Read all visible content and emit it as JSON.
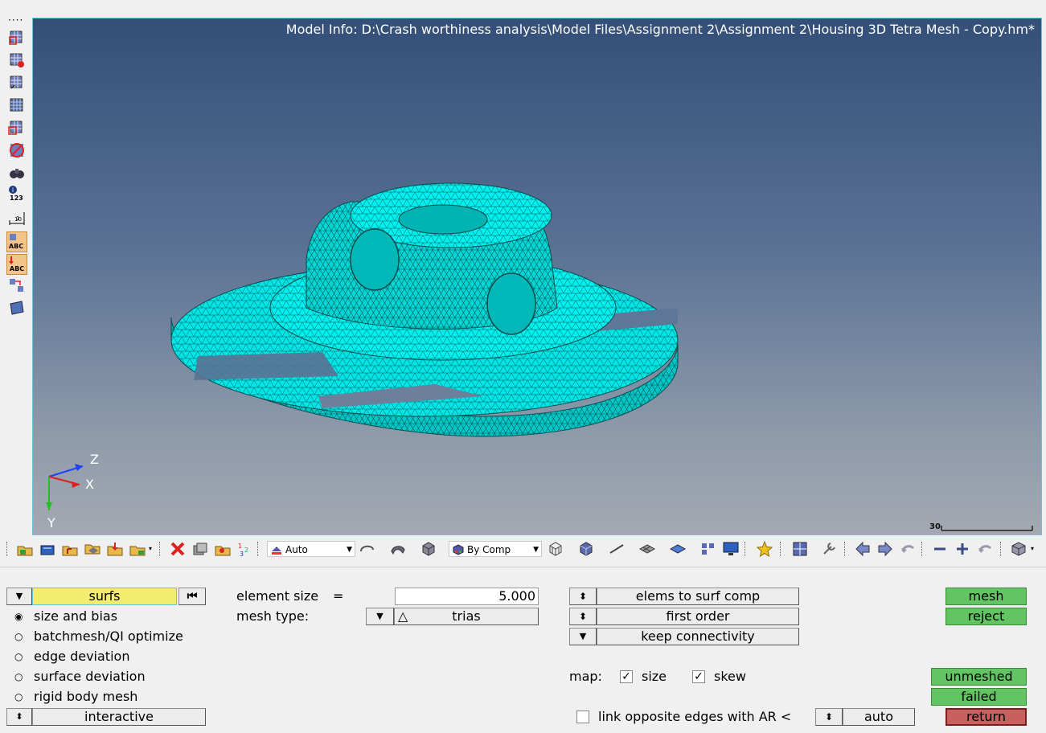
{
  "viewport": {
    "model_info": "Model Info: D:\\Crash worthiness analysis\\Model Files\\Assignment 2\\Assignment 2\\Housing 3D Tetra Mesh - Copy.hm*",
    "scale_label": "30",
    "axes": {
      "z": "Z",
      "x": "X",
      "y": "Y"
    },
    "mesh_color": "#00f0f0"
  },
  "left_toolbar": {
    "info_label": "123",
    "ruler_label": "10"
  },
  "main_toolbar": {
    "vis_mode": "Auto",
    "color_mode": "By Comp"
  },
  "panel": {
    "entity_selector": "surfs",
    "options": [
      {
        "label": "size and bias",
        "selected": true
      },
      {
        "label": "batchmesh/QI optimize",
        "selected": false
      },
      {
        "label": "edge deviation",
        "selected": false
      },
      {
        "label": "surface deviation",
        "selected": false
      },
      {
        "label": "rigid body mesh",
        "selected": false
      }
    ],
    "mode_button": "interactive",
    "element_size_label": "element size",
    "equals": "=",
    "element_size_value": "5.000",
    "mesh_type_label": "mesh type:",
    "mesh_type_value": "trias",
    "elems_to_surf_comp": "elems to surf comp",
    "first_order": "first order",
    "keep_connectivity": "keep connectivity",
    "map_label": "map:",
    "map_size": "size",
    "map_skew": "skew",
    "link_opposite_edges": "link opposite edges with AR <",
    "ar_mode": "auto",
    "mesh_button": "mesh",
    "reject_button": "reject",
    "unmeshed_button": "unmeshed",
    "failed_button": "failed",
    "return_button": "return"
  }
}
